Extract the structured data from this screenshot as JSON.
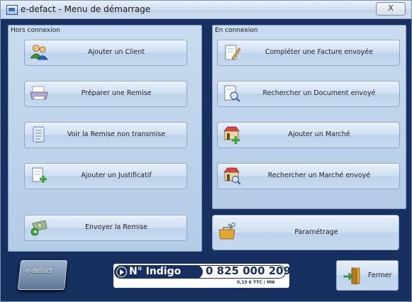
{
  "window": {
    "title": "e-defact - Menu de démarrage",
    "close_glyph": "X"
  },
  "offline": {
    "label": "Hors connexion",
    "buttons": [
      {
        "label": "Ajouter un Client",
        "icon": "users-icon"
      },
      {
        "label": "Préparer une Remise",
        "icon": "printer-icon"
      },
      {
        "label": "Voir la Remise non transmise",
        "icon": "scroll-document-icon"
      },
      {
        "label": "Ajouter un Justificatif",
        "icon": "add-document-icon"
      },
      {
        "label": "Envoyer la Remise",
        "icon": "send-money-icon"
      }
    ]
  },
  "online": {
    "label": "En connexion",
    "buttons": [
      {
        "label": "Compléter une Facture envoyée",
        "icon": "edit-invoice-icon"
      },
      {
        "label": "Rechercher un Document envoyé",
        "icon": "search-document-icon"
      },
      {
        "label": "Ajouter un Marché",
        "icon": "add-market-icon"
      },
      {
        "label": "Rechercher un Marché envoyé",
        "icon": "search-market-icon"
      }
    ]
  },
  "settings": {
    "label": "Paramétrage",
    "icon": "toolbox-icon"
  },
  "footer": {
    "logo_text": "e-defact",
    "indigo_brand": "N° Indigo",
    "indigo_number": "0 825 000 209",
    "indigo_price": "0,15 € TTC / MN",
    "close_label": "Fermer"
  }
}
